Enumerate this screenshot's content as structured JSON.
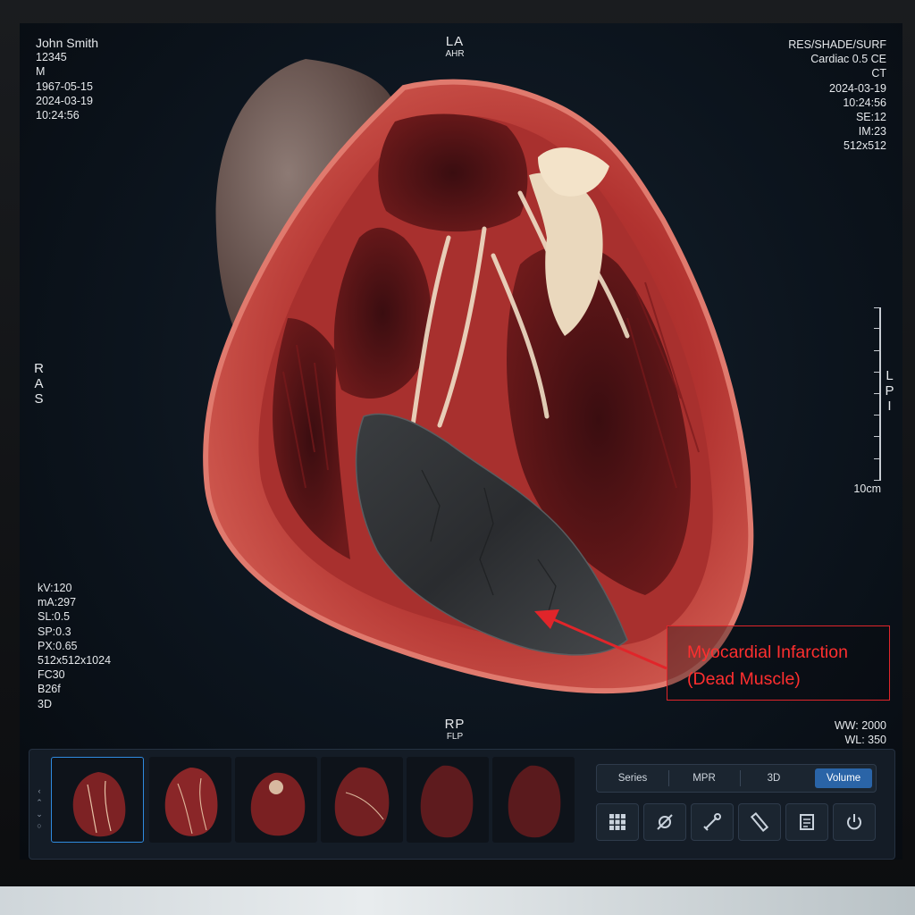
{
  "patient": {
    "name": "John Smith",
    "id": "12345",
    "sex": "M",
    "dob": "1967-05-15",
    "study_date": "2024-03-19",
    "study_time": "10:24:56"
  },
  "study_info": {
    "mode": "RES/SHADE/SURF",
    "protocol": "Cardiac 0.5 CE",
    "modality": "CT",
    "date": "2024-03-19",
    "time": "10:24:56",
    "series": "SE:12",
    "image": "IM:23",
    "matrix": "512x512"
  },
  "orientation": {
    "top": "LA",
    "top_sub": "AHR",
    "bottom": "RP",
    "bottom_sub": "FLP",
    "left_letters": [
      "R",
      "A",
      "S"
    ],
    "right_letters": [
      "L",
      "P",
      "I"
    ]
  },
  "acquisition": {
    "kv": "kV:120",
    "ma": "mA:297",
    "sl": "SL:0.5",
    "sp": "SP:0.3",
    "px": "PX:0.65",
    "volume": "512x512x1024",
    "fc": "FC30",
    "kernel": "B26f",
    "render": "3D"
  },
  "ruler": {
    "label": "10cm"
  },
  "window": {
    "ww": "WW: 2000",
    "wl": "WL: 350"
  },
  "annotation": {
    "line1": "Myocardial Infarction",
    "line2": "(Dead Muscle)",
    "color": "#e0252a"
  },
  "view_tabs": [
    {
      "label": "Series",
      "active": false
    },
    {
      "label": "MPR",
      "active": false
    },
    {
      "label": "3D",
      "active": false
    },
    {
      "label": "Volume",
      "active": true
    }
  ],
  "tools": [
    "grid-layout-icon",
    "crosshair-cursor-icon",
    "measure-tool-icon",
    "ruler-icon",
    "report-icon",
    "power-icon"
  ],
  "thumbnails": {
    "count": 6,
    "selected_index": 0
  },
  "colors": {
    "accent": "#2a64a7",
    "selection": "#2f8be0",
    "annotation": "#e0252a",
    "myocardium": "#c23a35"
  }
}
